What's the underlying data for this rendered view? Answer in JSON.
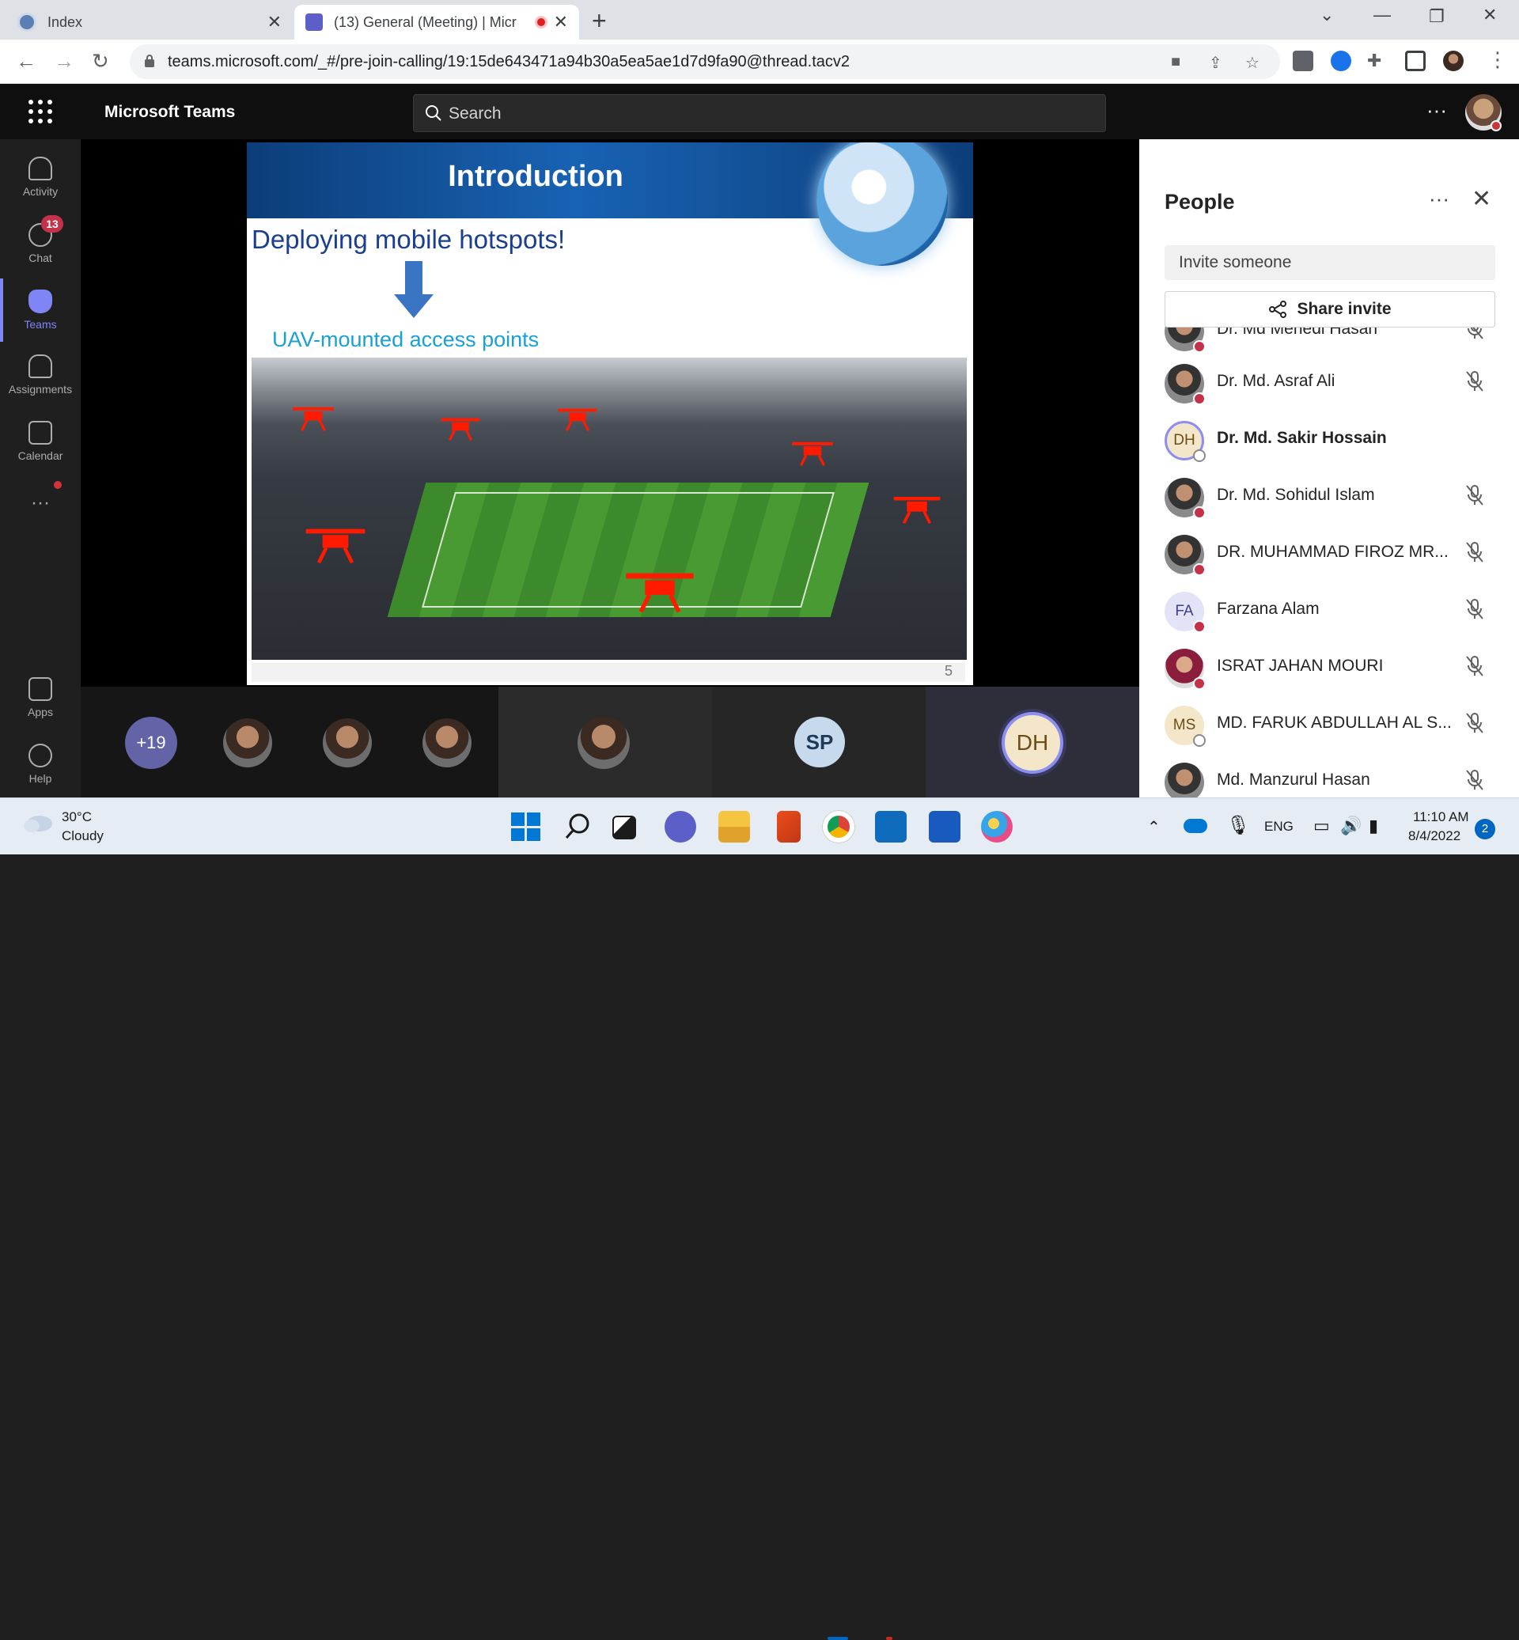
{
  "browser": {
    "tabs": [
      {
        "title": "Index",
        "active": false
      },
      {
        "title": "(13) General (Meeting) | Micr",
        "active": true
      }
    ],
    "url": "teams.microsoft.com/_#/pre-join-calling/19:15de643471a94b30a5ea5ae1d7d9fa90@thread.tacv2"
  },
  "teams": {
    "app_name": "Microsoft Teams",
    "search_placeholder": "Search",
    "rail": [
      {
        "label": "Activity",
        "icon": "bell-icon"
      },
      {
        "label": "Chat",
        "icon": "chat-icon",
        "badge": "13"
      },
      {
        "label": "Teams",
        "icon": "teams-icon",
        "selected": true
      },
      {
        "label": "Assignments",
        "icon": "assignments-icon"
      },
      {
        "label": "Calendar",
        "icon": "calendar-icon"
      },
      {
        "label": "Apps",
        "icon": "apps-icon"
      },
      {
        "label": "Help",
        "icon": "help-icon"
      }
    ]
  },
  "slide": {
    "title": "Introduction",
    "subtitle": "Deploying mobile hotspots!",
    "subtitle2": "UAV-mounted access points",
    "page_number": "5"
  },
  "strip": {
    "overflow": "+19",
    "initials_sp": "SP",
    "initials_dh": "DH"
  },
  "people": {
    "title": "People",
    "invite_placeholder": "Invite someone",
    "share_label": "Share invite",
    "participants": [
      {
        "name": "Dr. Md Mehedi Hasan",
        "avatar": "photo",
        "muted": true
      },
      {
        "name": "Dr. Md. Asraf Ali",
        "avatar": "photo",
        "muted": true
      },
      {
        "name": "Dr. Md. Sakir Hossain",
        "avatar": "DH",
        "bold": true,
        "muted": false
      },
      {
        "name": "Dr. Md. Sohidul Islam",
        "avatar": "photo",
        "muted": true
      },
      {
        "name": "DR. MUHAMMAD FIROZ MR...",
        "avatar": "photo",
        "muted": true
      },
      {
        "name": "Farzana Alam",
        "avatar": "FA",
        "muted": true
      },
      {
        "name": "ISRAT JAHAN MOURI",
        "avatar": "photo",
        "muted": true
      },
      {
        "name": "MD. FARUK ABDULLAH AL S...",
        "avatar": "MS",
        "muted": true
      },
      {
        "name": "Md. Manzurul Hasan",
        "avatar": "photo",
        "muted": true
      }
    ]
  },
  "taskbar": {
    "temp": "30°C",
    "condition": "Cloudy",
    "lang": "ENG",
    "time": "11:10 AM",
    "date": "8/4/2022",
    "notifications": "2"
  },
  "colors": {
    "teams_accent": "#6264a7",
    "presence_busy": "#c4314b",
    "slide_band": "#1862b3",
    "drone": "#ff1a00"
  }
}
